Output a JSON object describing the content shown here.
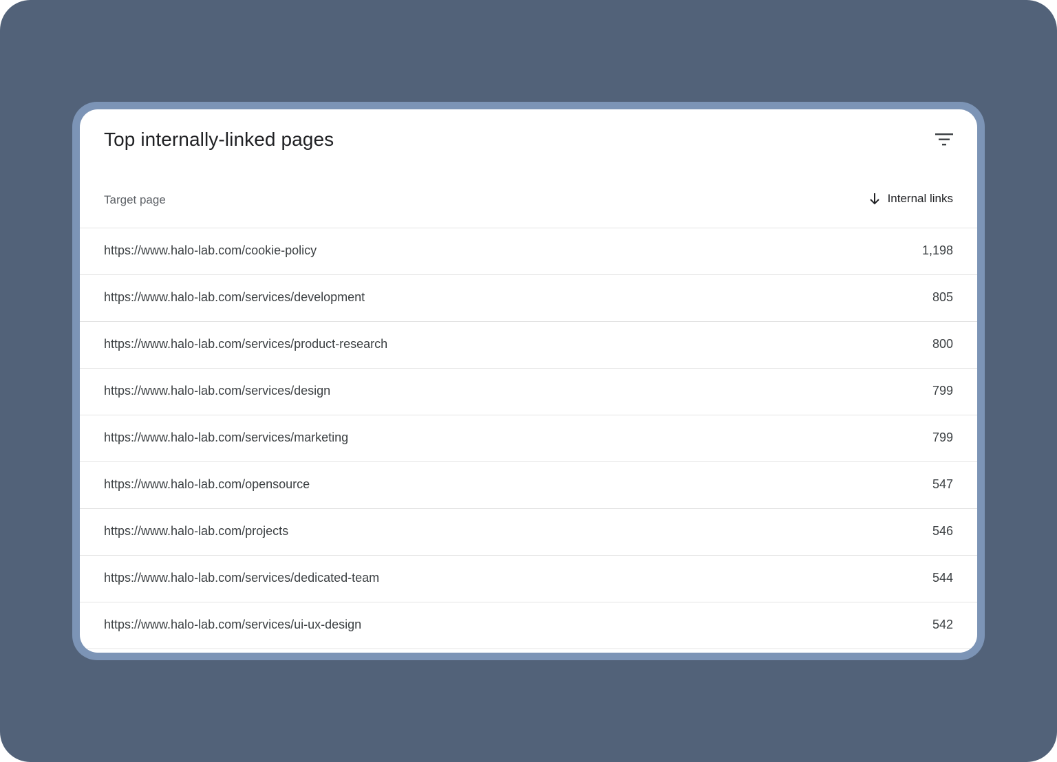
{
  "card": {
    "title": "Top internally-linked pages",
    "filter_icon": "filter-icon"
  },
  "table": {
    "columns": {
      "target_page": "Target page",
      "internal_links": "Internal links",
      "sort_icon": "arrow-down-icon",
      "sort_direction": "descending"
    },
    "rows": [
      {
        "url": "https://www.halo-lab.com/cookie-policy",
        "links": "1,198"
      },
      {
        "url": "https://www.halo-lab.com/services/development",
        "links": "805"
      },
      {
        "url": "https://www.halo-lab.com/services/product-research",
        "links": "800"
      },
      {
        "url": "https://www.halo-lab.com/services/design",
        "links": "799"
      },
      {
        "url": "https://www.halo-lab.com/services/marketing",
        "links": "799"
      },
      {
        "url": "https://www.halo-lab.com/opensource",
        "links": "547"
      },
      {
        "url": "https://www.halo-lab.com/projects",
        "links": "546"
      },
      {
        "url": "https://www.halo-lab.com/services/dedicated-team",
        "links": "544"
      },
      {
        "url": "https://www.halo-lab.com/services/ui-ux-design",
        "links": "542"
      }
    ]
  },
  "colors": {
    "backdrop": "#526279",
    "frame": "#7c94b6",
    "card": "#ffffff",
    "text_primary": "#202124",
    "text_secondary": "#5f6368",
    "divider": "#e3e3e3"
  }
}
